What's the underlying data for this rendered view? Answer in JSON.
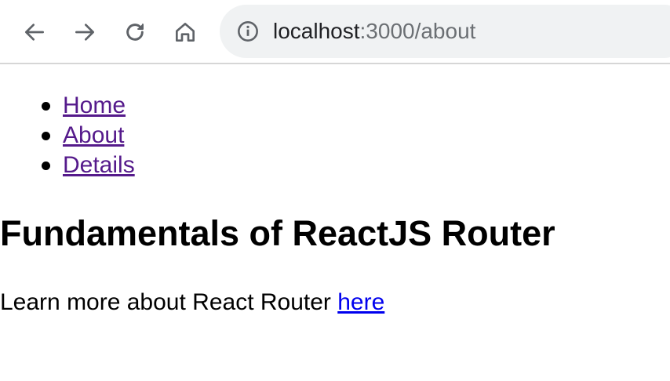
{
  "browser": {
    "toolbar_icons": [
      "back-arrow-icon",
      "forward-arrow-icon",
      "reload-icon",
      "home-icon",
      "info-icon"
    ],
    "url_host": "localhost",
    "url_rest": ":3000/about"
  },
  "nav": {
    "items": [
      {
        "label": "Home"
      },
      {
        "label": "About"
      },
      {
        "label": "Details"
      }
    ]
  },
  "main": {
    "heading": "Fundamentals of ReactJS Router",
    "paragraph_text": "Learn more about React Router ",
    "paragraph_link": "here"
  },
  "colors": {
    "visited_link": "#551a8b",
    "link": "#0000ee",
    "omnibox_bg": "#f0f2f3",
    "icon": "#5f6368"
  }
}
